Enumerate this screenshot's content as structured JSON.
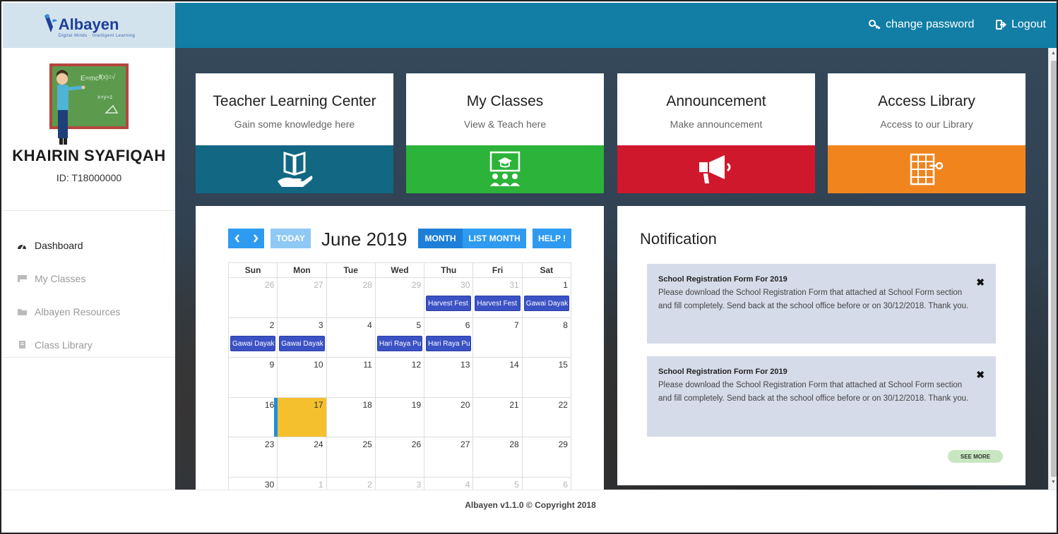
{
  "brand": {
    "name": "Albayen",
    "tagline": "Digital Minds · Intelligent Learning"
  },
  "topbar": {
    "change_password": "change password",
    "logout": "Logout"
  },
  "profile": {
    "name": "KHAIRIN SYAFIQAH",
    "id": "ID: T18000000"
  },
  "sidebar": {
    "items": [
      {
        "label": "Dashboard",
        "icon": "dashboard-icon",
        "active": true
      },
      {
        "label": "My Classes",
        "icon": "flag-icon",
        "active": false
      },
      {
        "label": "Albayen Resources",
        "icon": "folder-icon",
        "active": false
      },
      {
        "label": "Class Library",
        "icon": "book-icon",
        "active": false
      }
    ]
  },
  "cards": [
    {
      "title": "Teacher Learning Center",
      "subtitle": "Gain some knowledge here",
      "color": "#126783",
      "icon": "book-in-hand-icon"
    },
    {
      "title": "My Classes",
      "subtitle": "View & Teach here",
      "color": "#2cb33a",
      "icon": "classroom-icon"
    },
    {
      "title": "Announcement",
      "subtitle": "Make announcement",
      "color": "#d0182c",
      "icon": "megaphone-icon"
    },
    {
      "title": "Access Library",
      "subtitle": "Access to our Library",
      "color": "#f2841e",
      "icon": "library-icon"
    }
  ],
  "calendar": {
    "title": "June 2019",
    "today_label": "TODAY",
    "month_label": "MONTH",
    "list_month_label": "LIST MONTH",
    "help_label": "HELP !",
    "weekdays": [
      "Sun",
      "Mon",
      "Tue",
      "Wed",
      "Thu",
      "Fri",
      "Sat"
    ],
    "weeks": [
      [
        "26",
        "27",
        "28",
        "29",
        "30",
        "31",
        "1"
      ],
      [
        "2",
        "3",
        "4",
        "5",
        "6",
        "7",
        "8"
      ],
      [
        "9",
        "10",
        "11",
        "12",
        "13",
        "14",
        "15"
      ],
      [
        "16",
        "17",
        "18",
        "19",
        "20",
        "21",
        "22"
      ],
      [
        "23",
        "24",
        "25",
        "26",
        "27",
        "28",
        "29"
      ],
      [
        "30",
        "1",
        "2",
        "3",
        "4",
        "5",
        "6"
      ]
    ],
    "events": [
      {
        "label": "Harvest Fest",
        "week": 0,
        "day": 4
      },
      {
        "label": "Harvest Fest",
        "week": 0,
        "day": 5
      },
      {
        "label": "Gawai Dayak",
        "week": 0,
        "day": 6
      },
      {
        "label": "Gawai Dayak",
        "week": 1,
        "day": 0
      },
      {
        "label": "Gawai Dayak",
        "week": 1,
        "day": 1
      },
      {
        "label": "Hari Raya Pu",
        "week": 1,
        "day": 3
      },
      {
        "label": "Hari Raya Pu",
        "week": 1,
        "day": 4
      }
    ]
  },
  "notifications": {
    "title": "Notification",
    "items": [
      {
        "heading": "School Registration Form For 2019",
        "body": "Please download the School Registration Form that attached at School Form section and fill completely. Send back at the school office before or on 30/12/2018. Thank you."
      },
      {
        "heading": "School Registration Form For 2019",
        "body": "Please download the School Registration Form that attached at School Form section and fill completely. Send back at the school office before or on 30/12/2018. Thank you."
      }
    ],
    "close_symbol": "✖",
    "see_more": "SEE MORE"
  },
  "footer": {
    "text": "Albayen v1.1.0 © Copyright 2018"
  }
}
